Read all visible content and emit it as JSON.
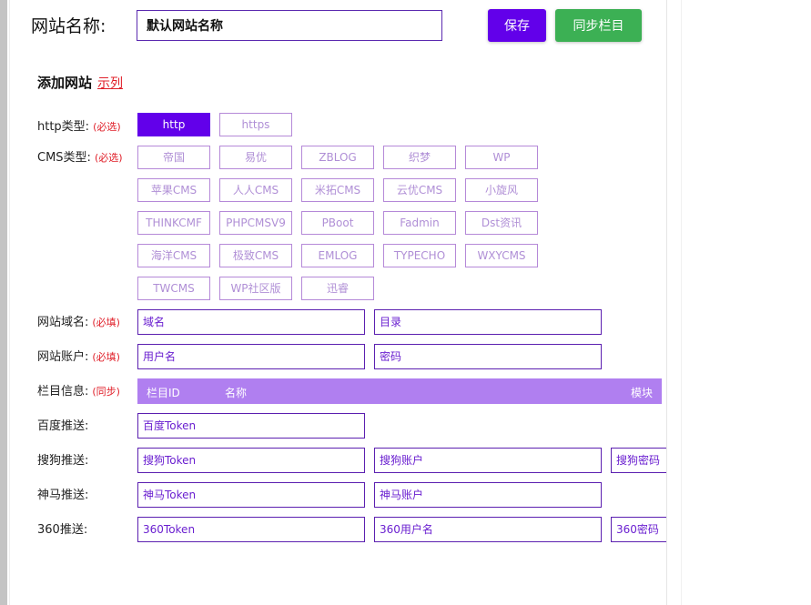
{
  "header": {
    "title": "网站名称:",
    "site_name": "默认网站名称",
    "save": "保存",
    "sync": "同步栏目"
  },
  "section": {
    "title": "添加网站",
    "example": "示列"
  },
  "http": {
    "label": "http类型:",
    "req": "(必选)",
    "options": [
      "http",
      "https"
    ],
    "selected": "http"
  },
  "cms": {
    "label": "CMS类型:",
    "req": "(必选)",
    "options": [
      "帝国",
      "易优",
      "ZBLOG",
      "织梦",
      "WP",
      "苹果CMS",
      "人人CMS",
      "米拓CMS",
      "云优CMS",
      "小旋风",
      "THINKCMF",
      "PHPCMSV9",
      "PBoot",
      "Fadmin",
      "Dst资讯",
      "海洋CMS",
      "极致CMS",
      "EMLOG",
      "TYPECHO",
      "WXYCMS",
      "TWCMS",
      "WP社区版",
      "迅睿"
    ]
  },
  "domain": {
    "label": "网站域名:",
    "req": "(必填)",
    "p1": "域名",
    "p2": "目录"
  },
  "account": {
    "label": "网站账户:",
    "req": "(必填)",
    "p1": "用户名",
    "p2": "密码"
  },
  "columns": {
    "label": "栏目信息:",
    "req": "(同步)",
    "h1": "栏目ID",
    "h2": "名称",
    "h3": "模块"
  },
  "baidu": {
    "label": "百度推送:",
    "p1": "百度Token"
  },
  "sogou": {
    "label": "搜狗推送:",
    "p1": "搜狗Token",
    "p2": "搜狗账户",
    "p3": "搜狗密码"
  },
  "shenma": {
    "label": "神马推送:",
    "p1": "神马Token",
    "p2": "神马账户"
  },
  "s360": {
    "label": "360推送:",
    "p1": "360Token",
    "p2": "360用户名",
    "p3": "360密码"
  },
  "colors": {
    "accent": "#6200ea",
    "green": "#3cb054",
    "header": "#b07ff0",
    "required": "#e0202a"
  }
}
